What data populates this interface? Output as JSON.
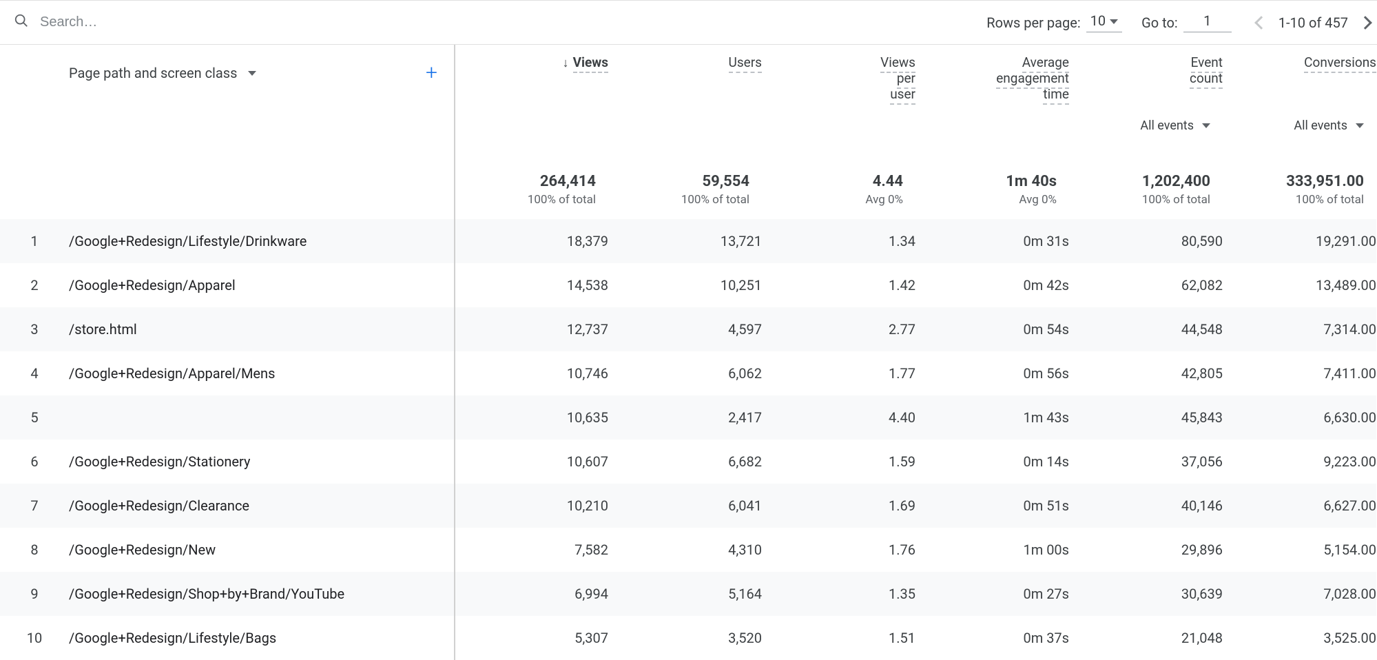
{
  "toolbar": {
    "search_placeholder": "Search…",
    "rows_label": "Rows per page:",
    "rows_value": "10",
    "goto_label": "Go to:",
    "goto_value": "1",
    "range_text": "1-10 of 457"
  },
  "dimension": {
    "label": "Page path and screen class"
  },
  "columns": [
    {
      "label": "Views",
      "sorted": true,
      "sub": null,
      "total": "264,414",
      "total_sub": "100% of total"
    },
    {
      "label": "Users",
      "sorted": false,
      "sub": null,
      "total": "59,554",
      "total_sub": "100% of total"
    },
    {
      "label": "Views per user",
      "sorted": false,
      "sub": null,
      "total": "4.44",
      "total_sub": "Avg 0%"
    },
    {
      "label": "Average engagement time",
      "sorted": false,
      "sub": null,
      "total": "1m 40s",
      "total_sub": "Avg 0%"
    },
    {
      "label": "Event count",
      "sorted": false,
      "sub": "All events",
      "total": "1,202,400",
      "total_sub": "100% of total"
    },
    {
      "label": "Conversions",
      "sorted": false,
      "sub": "All events",
      "total": "333,951.00",
      "total_sub": "100% of total"
    }
  ],
  "rows": [
    {
      "idx": "1",
      "path": "/Google+Redesign/Lifestyle/Drinkware",
      "v": [
        "18,379",
        "13,721",
        "1.34",
        "0m 31s",
        "80,590",
        "19,291.00"
      ]
    },
    {
      "idx": "2",
      "path": "/Google+Redesign/Apparel",
      "v": [
        "14,538",
        "10,251",
        "1.42",
        "0m 42s",
        "62,082",
        "13,489.00"
      ]
    },
    {
      "idx": "3",
      "path": "/store.html",
      "v": [
        "12,737",
        "4,597",
        "2.77",
        "0m 54s",
        "44,548",
        "7,314.00"
      ]
    },
    {
      "idx": "4",
      "path": "/Google+Redesign/Apparel/Mens",
      "v": [
        "10,746",
        "6,062",
        "1.77",
        "0m 56s",
        "42,805",
        "7,411.00"
      ]
    },
    {
      "idx": "5",
      "path": "",
      "v": [
        "10,635",
        "2,417",
        "4.40",
        "1m 43s",
        "45,843",
        "6,630.00"
      ]
    },
    {
      "idx": "6",
      "path": "/Google+Redesign/Stationery",
      "v": [
        "10,607",
        "6,682",
        "1.59",
        "0m 14s",
        "37,056",
        "9,223.00"
      ]
    },
    {
      "idx": "7",
      "path": "/Google+Redesign/Clearance",
      "v": [
        "10,210",
        "6,041",
        "1.69",
        "0m 51s",
        "40,146",
        "6,627.00"
      ]
    },
    {
      "idx": "8",
      "path": "/Google+Redesign/New",
      "v": [
        "7,582",
        "4,310",
        "1.76",
        "1m 00s",
        "29,896",
        "5,154.00"
      ]
    },
    {
      "idx": "9",
      "path": "/Google+Redesign/Shop+by+Brand/YouTube",
      "v": [
        "6,994",
        "5,164",
        "1.35",
        "0m 27s",
        "30,639",
        "7,028.00"
      ]
    },
    {
      "idx": "10",
      "path": "/Google+Redesign/Lifestyle/Bags",
      "v": [
        "5,307",
        "3,520",
        "1.51",
        "0m 37s",
        "21,048",
        "3,525.00"
      ]
    }
  ]
}
